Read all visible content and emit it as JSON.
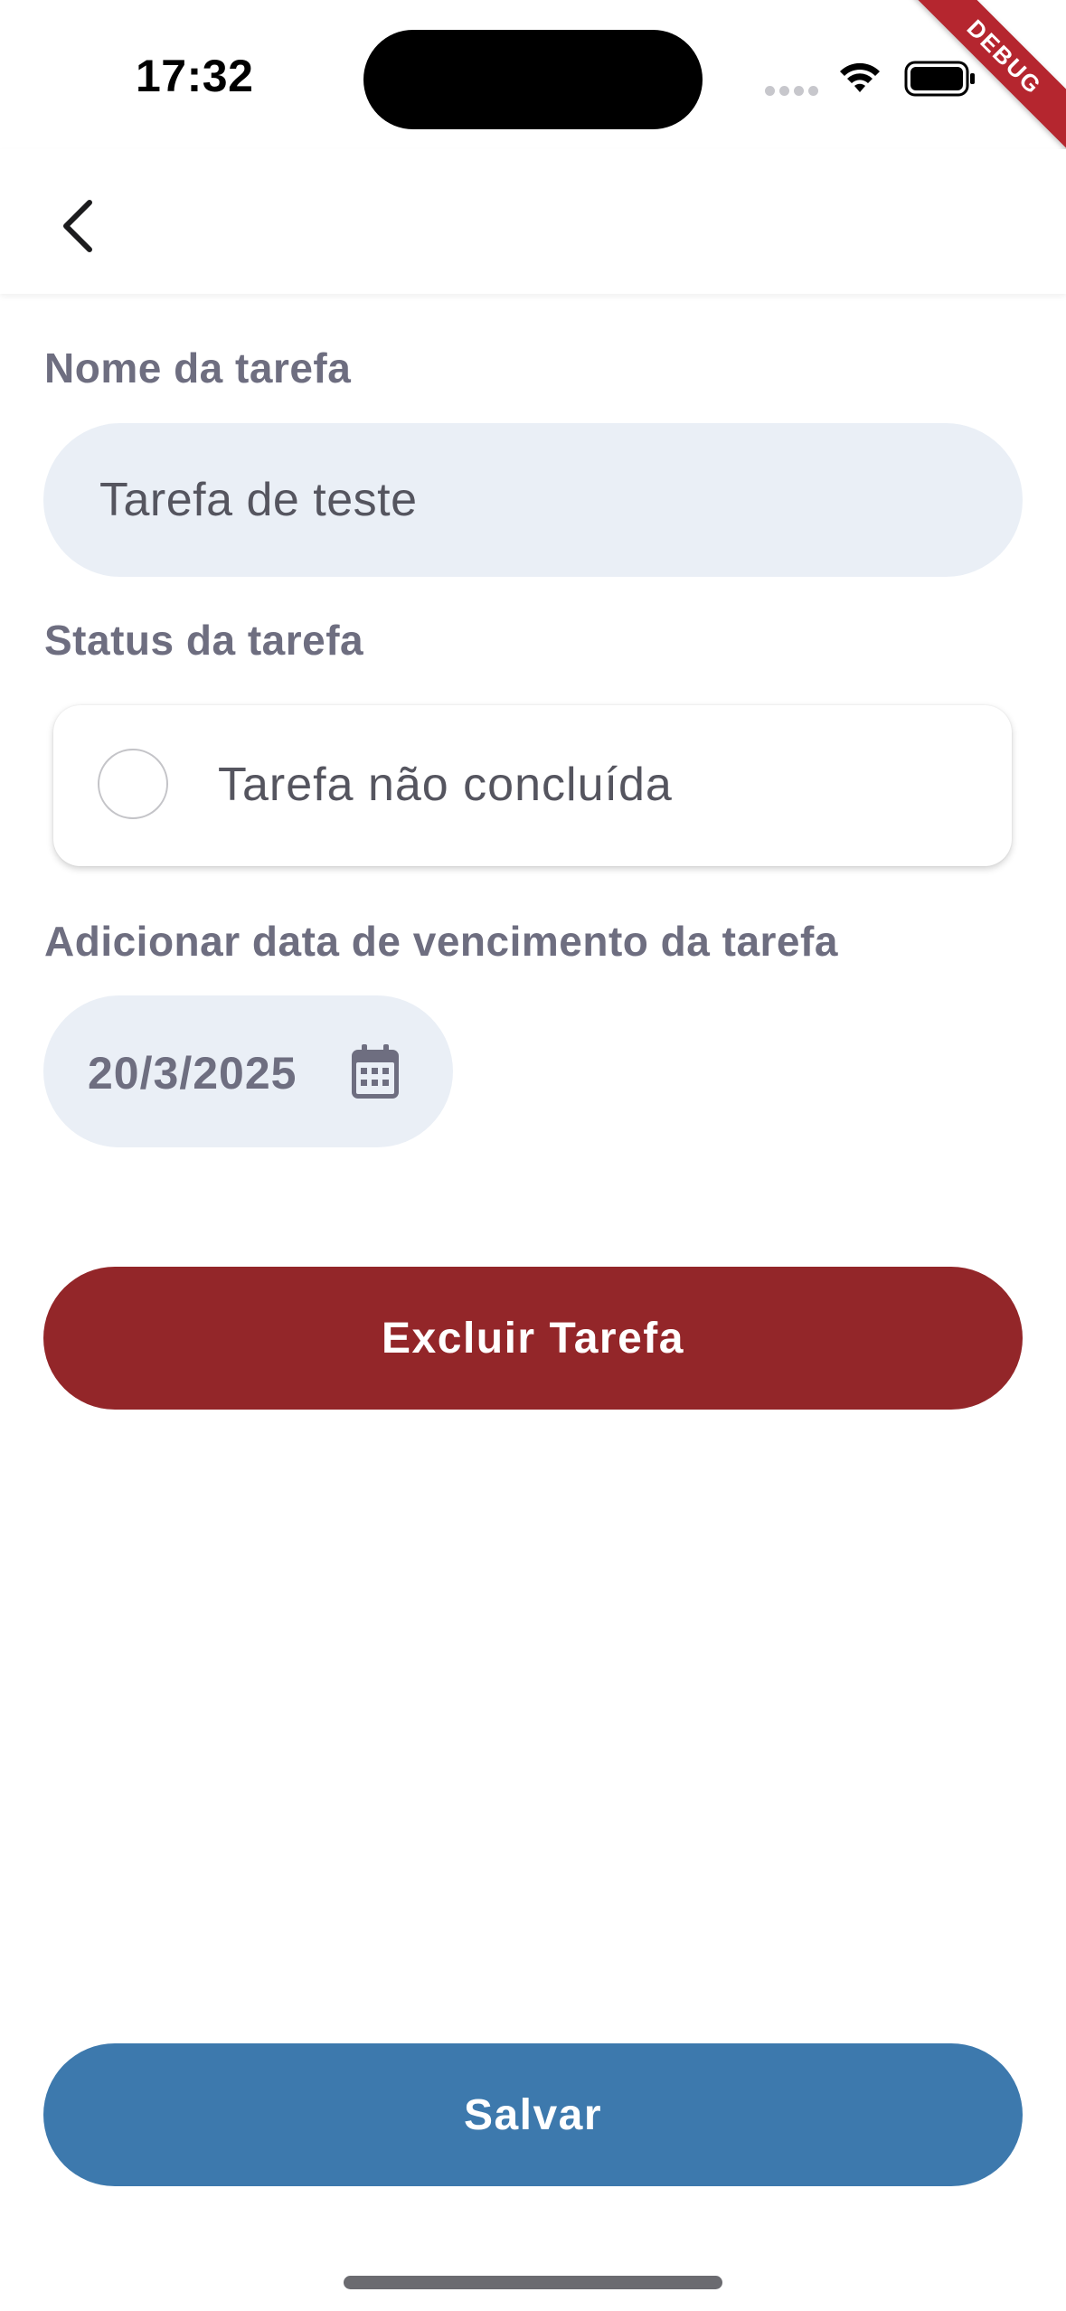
{
  "status_bar": {
    "time": "17:32",
    "debug_label": "DEBUG"
  },
  "app_bar": {
    "back_icon": "chevron-left-icon"
  },
  "form": {
    "task_name": {
      "label": "Nome da tarefa",
      "value": "Tarefa de teste"
    },
    "task_status": {
      "label": "Status da tarefa",
      "option_text": "Tarefa não concluída",
      "checked": false
    },
    "due_date": {
      "label": "Adicionar data de vencimento da tarefa",
      "value": "20/3/2025",
      "icon": "calendar-icon"
    }
  },
  "actions": {
    "delete_label": "Excluir Tarefa",
    "save_label": "Salvar"
  },
  "colors": {
    "delete_button": "#932629",
    "save_button": "#3d79ad",
    "input_background": "#eaeff6",
    "label_text": "#6e6e80"
  }
}
